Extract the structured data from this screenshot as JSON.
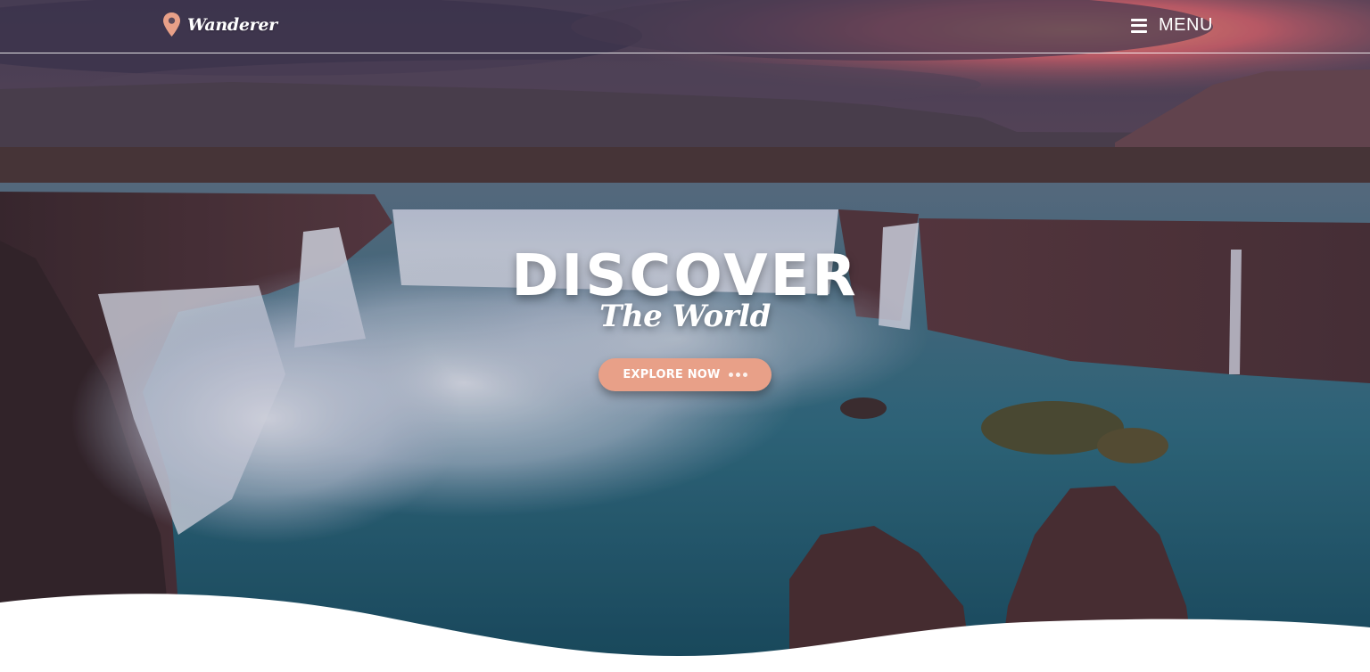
{
  "header": {
    "logo_text": "Wanderer",
    "logo_icon": "map-pin-icon",
    "menu_icon": "hamburger-icon",
    "menu_label": "MENU"
  },
  "hero": {
    "background": "waterfall-canyon-sunset-photo",
    "title": "DISCOVER",
    "subtitle": "The World",
    "cta_label": "EXPLORE NOW",
    "cta_icon": "ellipsis-dots-icon"
  },
  "colors": {
    "accent": "#e8a088",
    "text": "#ffffff"
  }
}
